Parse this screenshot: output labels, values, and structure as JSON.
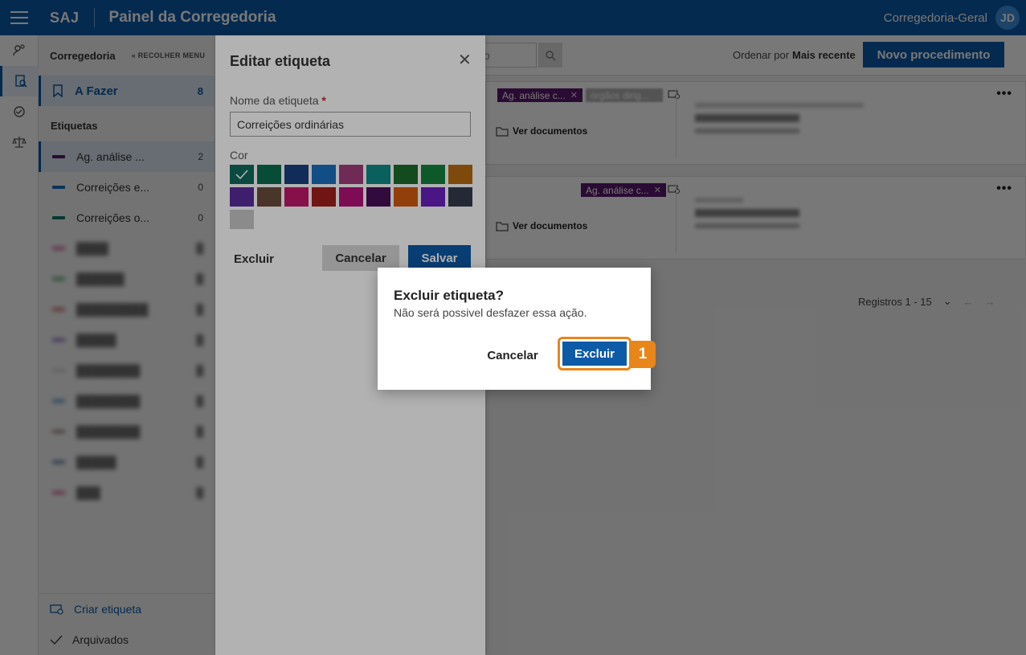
{
  "topbar": {
    "brand": "SAJ",
    "title": "Painel da Corregedoria",
    "user": "Corregedoria-Geral",
    "avatar_initials": "JD"
  },
  "sidenav": {
    "title": "Corregedoria",
    "collapse_label": "« RECOLHER MENU",
    "todo": {
      "label": "A Fazer",
      "count": "8"
    },
    "labels_heading": "Etiquetas",
    "items": [
      {
        "label": "Ag. análise ...",
        "count": "2",
        "color": "#5b1a6e"
      },
      {
        "label": "Correições e...",
        "count": "0",
        "color": "#1a6fbf"
      },
      {
        "label": "Correições o...",
        "count": "0",
        "color": "#0f7a6b"
      }
    ],
    "create_label": "Criar etiqueta",
    "archived_label": "Arquivados"
  },
  "toolbar": {
    "search_placeholder": "vo",
    "sort_label": "Ordenar por",
    "sort_value": "Mais recente",
    "new_button": "Novo procedimento"
  },
  "cards": [
    {
      "tags": [
        "Ag. análise c..."
      ],
      "docs_label": "Ver documentos"
    },
    {
      "tags": [
        "Ag. análise c..."
      ],
      "docs_label": "Ver documentos"
    }
  ],
  "pager": {
    "label": "Registros 1 - 15"
  },
  "edit_panel": {
    "title": "Editar etiqueta",
    "name_label": "Nome da etiqueta",
    "required_mark": "*",
    "name_value": "Correições ordinárias",
    "color_label": "Cor",
    "delete_label": "Excluir",
    "cancel_label": "Cancelar",
    "save_label": "Salvar",
    "swatches": [
      "#0f6b5e",
      "#0b6e4f",
      "#1b3f80",
      "#1a6fbf",
      "#a03d7a",
      "#0d8a86",
      "#1c6b2c",
      "#15803d",
      "#b46a12",
      "#5b2d9c",
      "#6b4d3d",
      "#c2186b",
      "#a11d1d",
      "#b3127a",
      "#4a0f58",
      "#d35b10",
      "#6b1fbf",
      "#333d4d",
      "#c8c8c8"
    ]
  },
  "dialog": {
    "title": "Excluir etiqueta?",
    "message": "Não será possivel desfazer essa ação.",
    "cancel_label": "Cancelar",
    "confirm_label": "Excluir",
    "step_number": "1"
  }
}
